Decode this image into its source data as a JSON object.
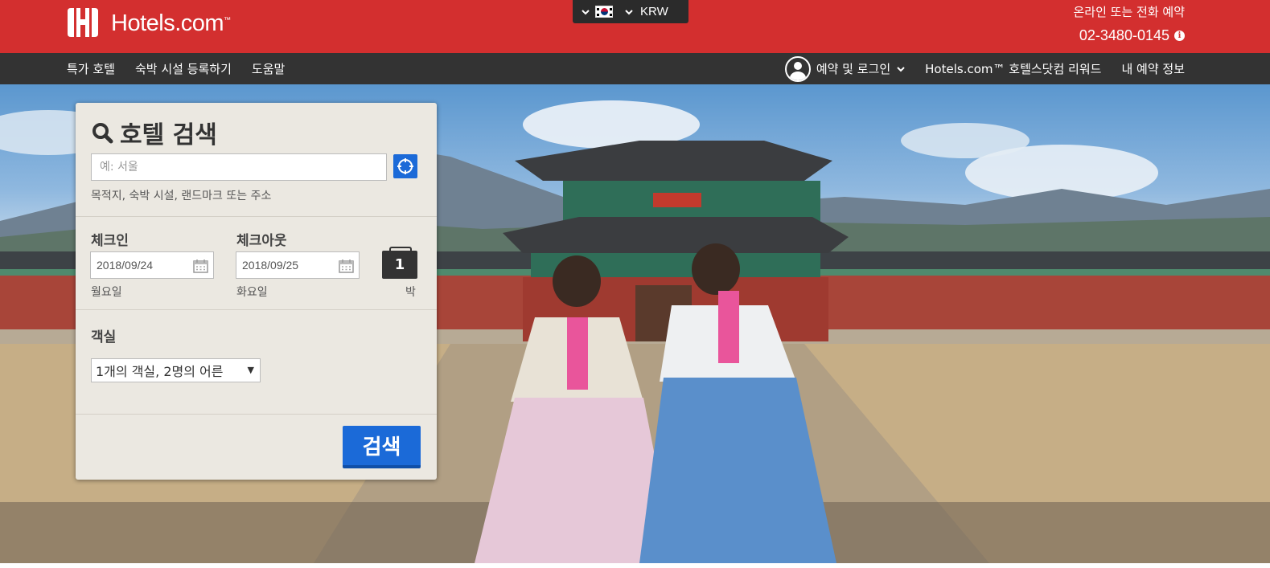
{
  "header": {
    "logo_text": "Hotels.com",
    "logo_tm": "™",
    "locale": {
      "flag": "korea-flag-icon",
      "currency": "KRW"
    },
    "contact": {
      "label": "온라인 또는 전화 예약",
      "phone": "02-3480-0145"
    }
  },
  "nav": {
    "left": [
      "특가 호텔",
      "숙박 시설 등록하기",
      "도움말"
    ],
    "login": "예약 및 로그인",
    "rewards": "Hotels.com™ 호텔스닷컴 리워드",
    "my_bookings": "내 예약 정보"
  },
  "search": {
    "title": "호텔 검색",
    "destination_placeholder": "예: 서울",
    "destination_value": "",
    "destination_hint": "목적지, 숙박 시설, 랜드마크 또는 주소",
    "checkin_label": "체크인",
    "checkin_date": "2018/09/24",
    "checkin_weekday": "월요일",
    "checkout_label": "체크아웃",
    "checkout_date": "2018/09/25",
    "checkout_weekday": "화요일",
    "nights": "1",
    "nights_label": "박",
    "rooms_label": "객실",
    "rooms_value": "1개의 객실, 2명의 어른",
    "submit_label": "검색"
  },
  "colors": {
    "brand_red": "#d32f2f",
    "nav_dark": "#333333",
    "button_blue": "#1b6ad8"
  }
}
